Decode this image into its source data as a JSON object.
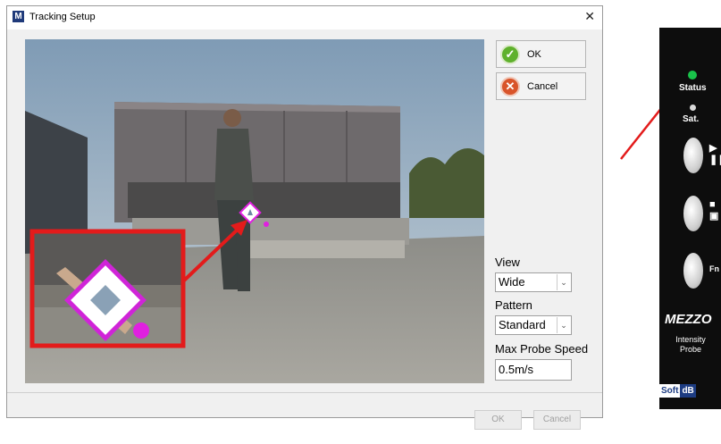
{
  "window": {
    "app_icon": "M",
    "title": "Tracking Setup",
    "close": "✕"
  },
  "actions": {
    "ok_label": "OK",
    "cancel_label": "Cancel",
    "ok_icon": "check-circle-icon",
    "cancel_icon": "x-circle-icon"
  },
  "settings": {
    "view_label": "View",
    "view_value": "Wide",
    "pattern_label": "Pattern",
    "pattern_value": "Standard",
    "max_speed_label": "Max Probe Speed",
    "max_speed_value": "0.5m/s"
  },
  "footer": {
    "ok_label": "OK",
    "cancel_label": "Cancel"
  },
  "device": {
    "status_label": "Status",
    "sat_label": "Sat.",
    "fn_label": "Fn",
    "brand": "MEZZO",
    "subtitle_line1": "Intensity",
    "subtitle_line2": "Probe",
    "logo_soft": "Soft",
    "logo_db": "dB"
  },
  "colors": {
    "highlight_box": "#e31b1b",
    "marker": "#e020e0",
    "status_led": "#19c24a"
  }
}
